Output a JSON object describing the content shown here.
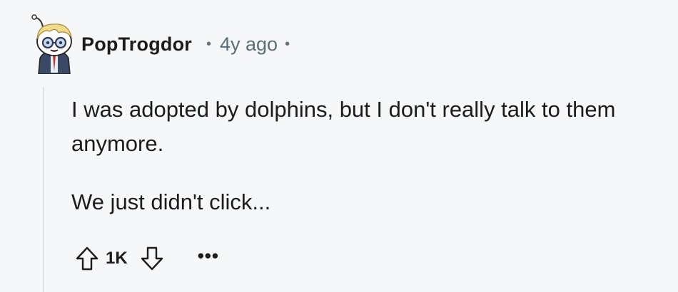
{
  "comment": {
    "author": "PopTrogdor",
    "separator": "•",
    "time": "4y ago",
    "trailing_separator": "•",
    "body": [
      "I was adopted by dolphins, but I don't really talk to them anymore.",
      "We just didn't click..."
    ],
    "score": "1K",
    "more_label": "•••"
  },
  "icons": {
    "avatar": "snoo-avatar-icon",
    "upvote": "arrow-up-icon",
    "downvote": "arrow-down-icon",
    "more": "ellipsis-icon"
  },
  "colors": {
    "background": "#f6f7f8",
    "text": "#1c1c1c",
    "meta": "#576f76",
    "thread_line": "#dfe1e3"
  }
}
